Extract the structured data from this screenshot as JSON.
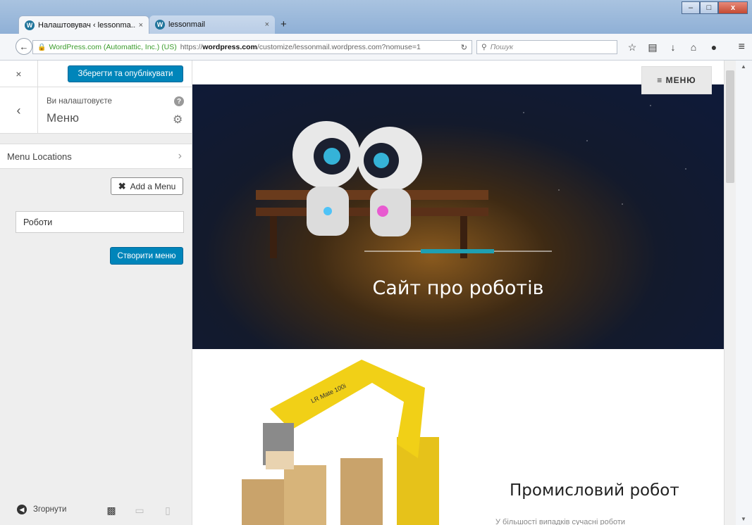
{
  "browser": {
    "tabs": [
      {
        "label": "Налаштовувач ‹ lessonma...",
        "close": "×"
      },
      {
        "label": "lessonmail",
        "close": "×"
      }
    ],
    "new_tab": "+",
    "url": {
      "identity": "WordPress.com (Automattic, Inc.) (US)",
      "prefix": "https://",
      "domain": "wordpress.com",
      "rest": "/customize/lessonmail.wordpress.com?nomuse=1"
    },
    "search_placeholder": "Пошук",
    "window_controls": [
      "–",
      "□",
      "x"
    ]
  },
  "sidebar": {
    "close": "×",
    "publish_label": "Зберегти та опублікувати",
    "customizing_label": "Ви налаштовуєте",
    "section_title": "Меню",
    "menu_locations_label": "Menu Locations",
    "add_menu_label": "Add a Menu",
    "menu_name_value": "Роботи",
    "create_menu_label": "Створити меню",
    "collapse_label": "Згорнути"
  },
  "preview": {
    "menu_toggle_label": "≡ МЕНЮ",
    "site_title": "Сайт про роботів",
    "slider_progress": 0.39,
    "post_title": "Промисловий робот",
    "post_excerpt": "У більшості випадків сучасні роботи"
  },
  "icons": {
    "back": "back-arrow-icon",
    "lock": "lock-icon",
    "reload": "reload-icon",
    "search": "search-icon",
    "bookmark": "star-icon",
    "help": "help-icon",
    "gear": "gear-icon"
  },
  "colors": {
    "primary_button": "#0085ba",
    "accent": "#1f9fb1"
  }
}
